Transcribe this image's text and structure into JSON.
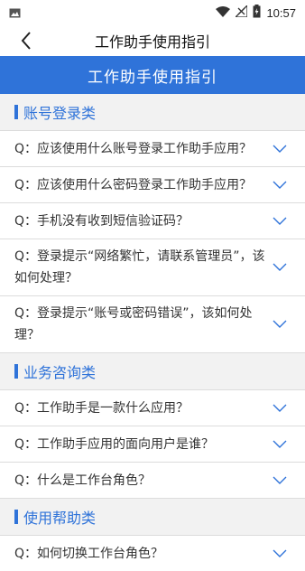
{
  "statusbar": {
    "time": "10:57"
  },
  "nav": {
    "title": "工作助手使用指引"
  },
  "banner": {
    "title": "工作助手使用指引"
  },
  "sections": [
    {
      "title": "账号登录类",
      "items": [
        "Q：应该使用什么账号登录工作助手应用？",
        "Q：应该使用什么密码登录工作助手应用？",
        "Q：手机没有收到短信验证码？",
        "Q：登录提示“网络繁忙，请联系管理员”，该如何处理？",
        "Q：登录提示“账号或密码错误”，该如何处理？"
      ]
    },
    {
      "title": "业务咨询类",
      "items": [
        "Q：工作助手是一款什么应用？",
        "Q：工作助手应用的面向用户是谁？",
        "Q：什么是工作台角色？"
      ]
    },
    {
      "title": "使用帮助类",
      "items": [
        "Q：如何切换工作台角色？"
      ]
    }
  ]
}
